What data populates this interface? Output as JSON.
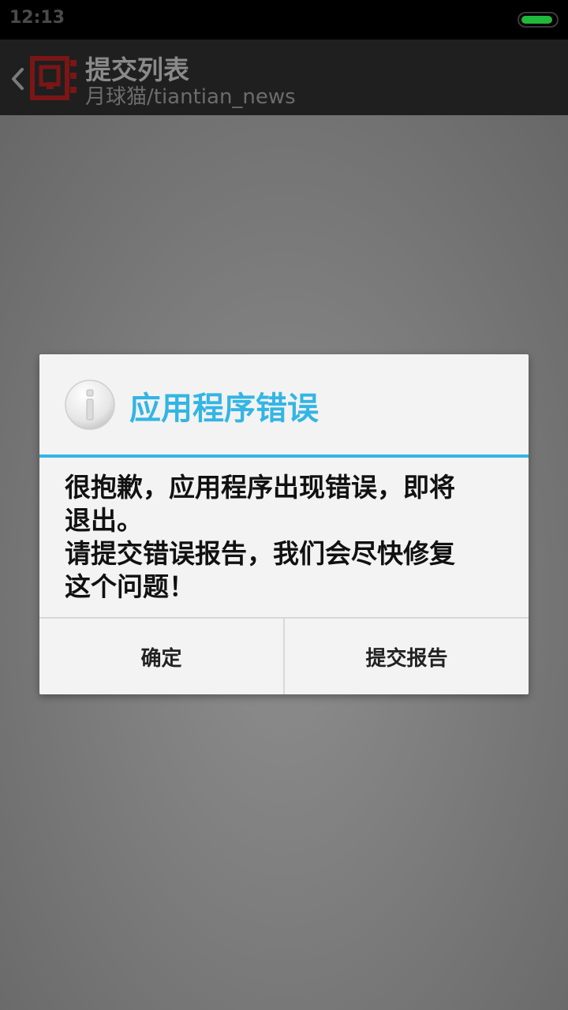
{
  "status_bar": {
    "time": "12:13",
    "battery_level": 0.92,
    "battery_color": "#21b83c"
  },
  "action_bar": {
    "title": "提交列表",
    "subtitle": "月球猫/tiantian_news",
    "back_icon": "chevron-left-icon",
    "logo_icon": "app-logo-icon",
    "logo_color": "#8b1a1a"
  },
  "dialog": {
    "icon": "info-icon",
    "title": "应用程序错误",
    "accent_color": "#33b5e5",
    "message_lines": [
      "很抱歉，应用程序出现错误，即将",
      "退出。",
      "请提交错误报告，我们会尽快修复",
      "这个问题！"
    ],
    "buttons": {
      "ok": "确定",
      "report": "提交报告"
    }
  }
}
